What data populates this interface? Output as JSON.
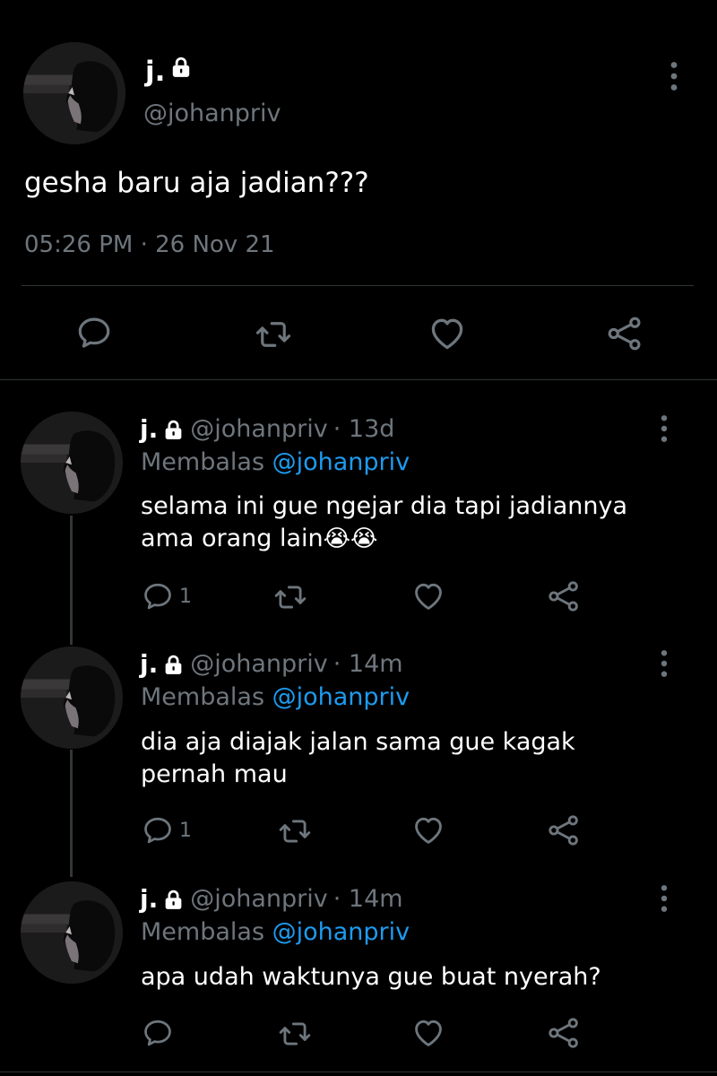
{
  "main_tweet": {
    "display_name": "j.",
    "handle": "@johanpriv",
    "text": "gesha baru aja jadian???",
    "timestamp": "05:26 PM · 26 Nov 21"
  },
  "replies": [
    {
      "display_name": "j.",
      "handle": "@johanpriv",
      "time": "· 13d",
      "replying_label": "Membalas",
      "replying_to": "@johanpriv",
      "text_line1": "selama ini gue ngejar dia tapi jadiannya",
      "text_line2": "ama orang lain",
      "emoji": "😭😭",
      "reply_count": "1"
    },
    {
      "display_name": "j.",
      "handle": "@johanpriv",
      "time": "· 14m",
      "replying_label": "Membalas",
      "replying_to": "@johanpriv",
      "text_line1": "dia aja diajak jalan sama gue kagak",
      "text_line2": "pernah mau",
      "reply_count": "1"
    },
    {
      "display_name": "j.",
      "handle": "@johanpriv",
      "time": "· 14m",
      "replying_label": "Membalas",
      "replying_to": "@johanpriv",
      "text_line1": "apa udah waktunya gue buat nyerah?",
      "reply_count": ""
    }
  ],
  "icons": {
    "reply": "reply-icon",
    "retweet": "retweet-icon",
    "like": "heart-icon",
    "share": "share-icon",
    "lock": "lock-icon",
    "more": "more-vertical-icon"
  },
  "colors": {
    "background": "#000000",
    "text": "#ffffff",
    "muted": "#6e767d",
    "link": "#1d9bf0",
    "divider": "#2f3336"
  }
}
